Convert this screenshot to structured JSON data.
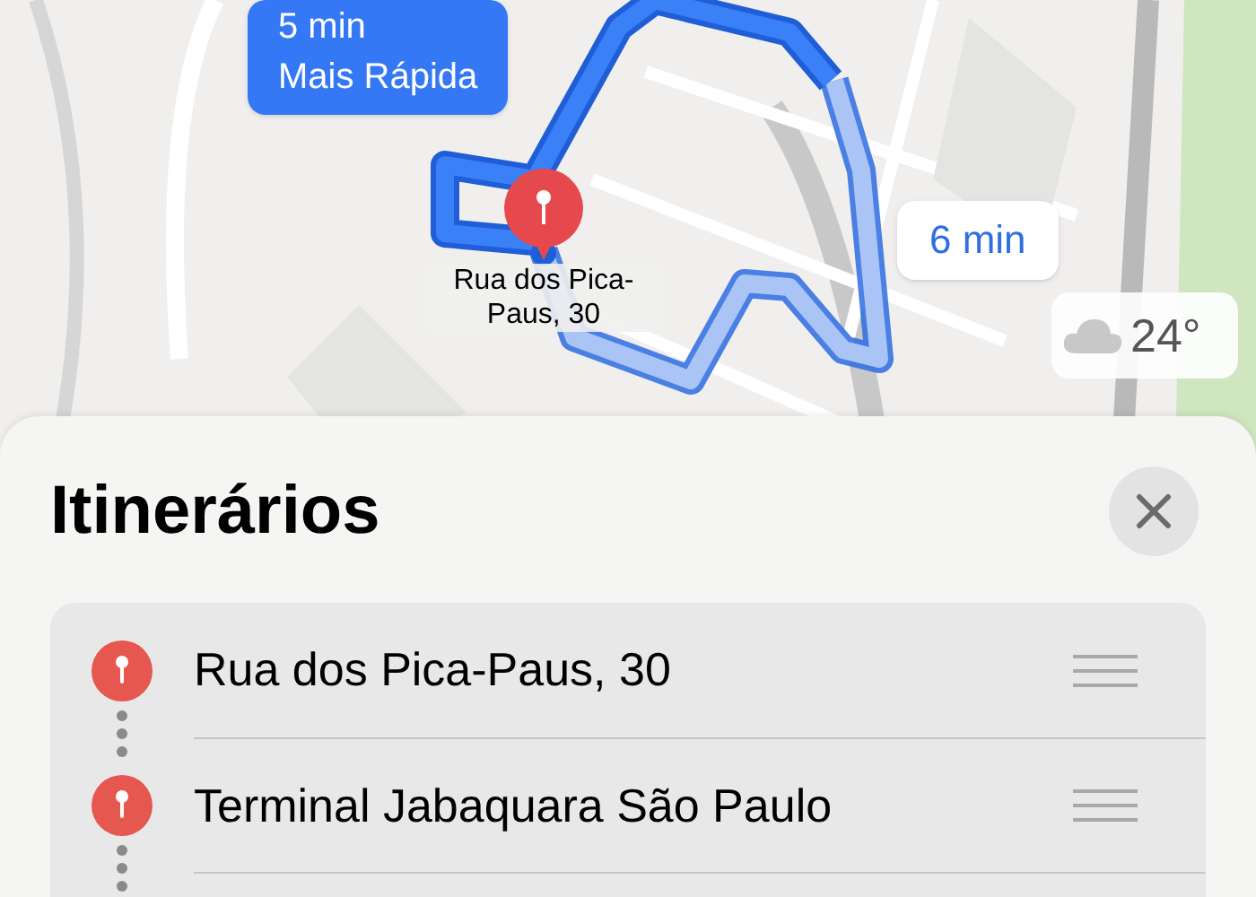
{
  "map": {
    "kind": "picture",
    "fastest_callout": {
      "time": "5 min",
      "label": "Mais Rápida",
      "selected": true
    },
    "alternative_callout": {
      "time": "6 min",
      "selected": false
    },
    "pin_label": "Rua dos Pica-Paus, 30",
    "weather": {
      "temperature": "24°"
    }
  },
  "sheet": {
    "title": "Itinerários",
    "stops": [
      {
        "name": "Rua dos Pica-Paus, 30"
      },
      {
        "name": "Terminal Jabaquara São Paulo"
      }
    ]
  }
}
